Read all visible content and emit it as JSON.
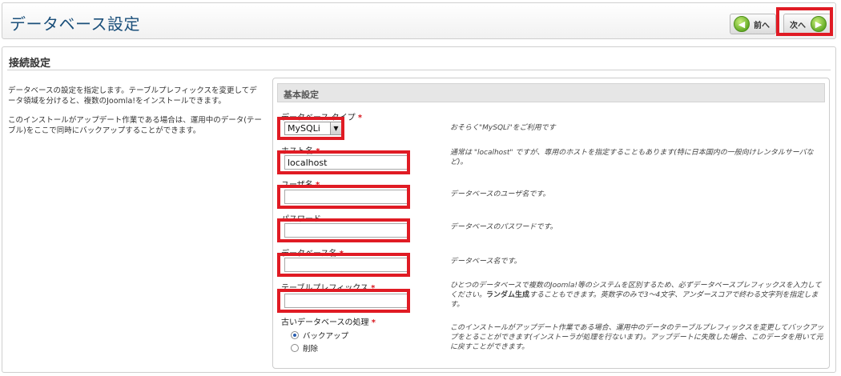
{
  "header": {
    "title": "データベース設定",
    "prev_label": "前へ",
    "next_label": "次へ"
  },
  "section": {
    "title": "接続設定",
    "intro_p1": "データベースの設定を指定します。テーブルプレフィックスを変更してデータ領域を分けると、複数のJoomla!をインストールできます。",
    "intro_p2": "このインストールがアップデート作業である場合は、運用中のデータ(テーブル)をここで同時にバックアップすることができます。"
  },
  "basic": {
    "heading": "基本設定",
    "required_mark": "*",
    "db_type": {
      "label": "データベース タイプ",
      "value": "MySQLi",
      "help": "おそらく\"MySQLi\"をご利用です"
    },
    "host": {
      "label": "ホスト名",
      "value": "localhost",
      "help": "通常は \"localhost\" ですが、専用のホストを指定することもあります(特に日本国内の一般向けレンタルサーバなど)。"
    },
    "user": {
      "label": "ユーザ名",
      "value": "",
      "help": "データベースのユーザ名です。"
    },
    "password": {
      "label": "パスワード",
      "value": "",
      "help": "データベースのパスワードです。"
    },
    "db_name": {
      "label": "データベース名",
      "value": "",
      "help": "データベース名です。"
    },
    "prefix": {
      "label": "テーブルプレフィックス",
      "value": "",
      "help_pre": "ひとつのデータベースで複数のJoomla!等のシステムを区別するため、必ずデータベースプレフィックスを入力してください。",
      "help_bold": "ランダム生成",
      "help_post": "することもできます。英数字のみで3～4文字、アンダースコアで終わる文字列を指定します。"
    },
    "old_db": {
      "label": "古いデータベースの処理",
      "opt_backup": "バックアップ",
      "opt_delete": "削除",
      "help": "このインストールがアップデート作業である場合、運用中のデータのテーブルプレフィックスを変更してバックアップをとることができます(インストーラが処理を行ないます)。アップデートに失敗した場合、このデータを用いて元に戻すことができます。"
    }
  },
  "colors": {
    "title_blue": "#1a4f7a",
    "highlight_red": "#e01b24",
    "required_red": "#d8171e",
    "button_green": "#5fa822"
  },
  "icons": {
    "prev": "arrow-left-circle-icon",
    "next": "arrow-right-circle-icon",
    "select": "triangle-down-icon"
  }
}
